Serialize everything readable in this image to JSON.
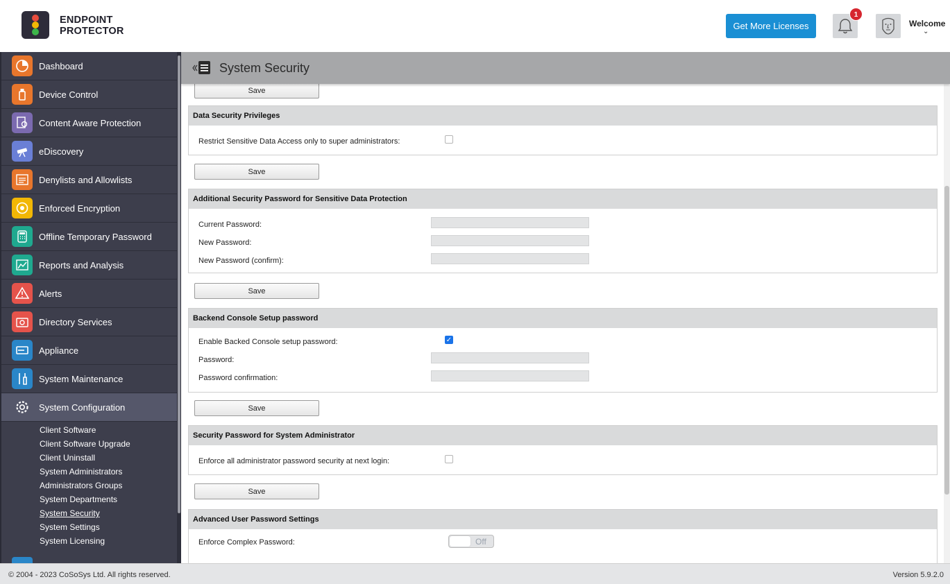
{
  "brand": {
    "line1": "ENDPOINT",
    "line2": "PROTECTOR"
  },
  "header": {
    "licenses_button": "Get More Licenses",
    "notification_count": "1",
    "user_label": "Welcome"
  },
  "sidebar": {
    "items": [
      {
        "label": "Dashboard",
        "icon": "pie-chart-icon",
        "color": "#e8762c"
      },
      {
        "label": "Device Control",
        "icon": "usb-icon",
        "color": "#e8762c"
      },
      {
        "label": "Content Aware Protection",
        "icon": "document-search-icon",
        "color": "#7b6ab0"
      },
      {
        "label": "eDiscovery",
        "icon": "telescope-icon",
        "color": "#6a7fd6"
      },
      {
        "label": "Denylists and Allowlists",
        "icon": "list-icon",
        "color": "#e8762c"
      },
      {
        "label": "Enforced Encryption",
        "icon": "encryption-icon",
        "color": "#f2b705"
      },
      {
        "label": "Offline Temporary Password",
        "icon": "keypad-icon",
        "color": "#1fa98f"
      },
      {
        "label": "Reports and Analysis",
        "icon": "chart-icon",
        "color": "#1fa98f"
      },
      {
        "label": "Alerts",
        "icon": "warning-icon",
        "color": "#e5534b"
      },
      {
        "label": "Directory Services",
        "icon": "directory-icon",
        "color": "#e5534b"
      },
      {
        "label": "Appliance",
        "icon": "appliance-icon",
        "color": "#2a86c8"
      },
      {
        "label": "System Maintenance",
        "icon": "tools-icon",
        "color": "#2a86c8"
      },
      {
        "label": "System Configuration",
        "icon": "gear-icon",
        "color": "#55576a"
      }
    ],
    "sub_items": [
      "Client Software",
      "Client Software Upgrade",
      "Client Uninstall",
      "System Administrators",
      "Administrators Groups",
      "System Departments",
      "System Security",
      "System Settings",
      "System Licensing"
    ]
  },
  "page": {
    "title": "System Security"
  },
  "save_label": "Save",
  "sections": {
    "data_security": {
      "title": "Data Security Privileges",
      "restrict_label": "Restrict Sensitive Data Access only to super administrators:",
      "restrict_checked": false
    },
    "additional_password": {
      "title": "Additional Security Password for Sensitive Data Protection",
      "current": "Current Password:",
      "new": "New Password:",
      "confirm": "New Password (confirm):"
    },
    "backend_console": {
      "title": "Backend Console Setup password",
      "enable_label": "Enable Backed Console setup password:",
      "enable_checked": true,
      "password": "Password:",
      "confirmation": "Password confirmation:"
    },
    "admin_security": {
      "title": "Security Password for System Administrator",
      "enforce_label": "Enforce all administrator password security at next login:",
      "enforce_checked": false
    },
    "advanced_user": {
      "title": "Advanced User Password Settings",
      "complex_label": "Enforce Complex Password:",
      "complex_state": "Off"
    }
  },
  "footer": {
    "copyright": "© 2004 - 2023 CoSoSys Ltd. All rights reserved.",
    "version": "Version 5.9.2.0"
  }
}
